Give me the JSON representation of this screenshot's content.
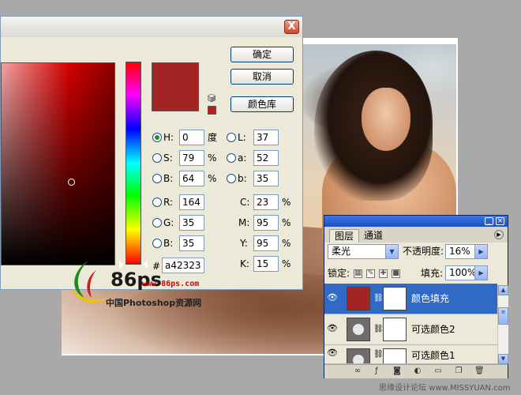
{
  "colors": {
    "selected_color": "#a42323",
    "web_swatch": "#b2221e",
    "layer_thumb": "#a42323"
  },
  "picker": {
    "close_label": "X",
    "buttons": {
      "ok": "确定",
      "cancel": "取消",
      "libraries": "颜色库"
    },
    "hsb": {
      "h": {
        "label": "H:",
        "value": "0",
        "unit": "度"
      },
      "s": {
        "label": "S:",
        "value": "79",
        "unit": "%"
      },
      "b": {
        "label": "B:",
        "value": "64",
        "unit": "%"
      }
    },
    "rgb": {
      "r": {
        "label": "R:",
        "value": "164"
      },
      "g": {
        "label": "G:",
        "value": "35"
      },
      "b": {
        "label": "B:",
        "value": "35"
      }
    },
    "lab": {
      "l": {
        "label": "L:",
        "value": "37"
      },
      "a": {
        "label": "a:",
        "value": "52"
      },
      "b": {
        "label": "b:",
        "value": "35"
      }
    },
    "cmyk": {
      "c": {
        "label": "C:",
        "value": "23",
        "unit": "%"
      },
      "m": {
        "label": "M:",
        "value": "95",
        "unit": "%"
      },
      "y": {
        "label": "Y:",
        "value": "95",
        "unit": "%"
      },
      "k": {
        "label": "K:",
        "value": "15",
        "unit": "%"
      }
    },
    "hex": {
      "label": "#",
      "value": "a42323"
    }
  },
  "layers": {
    "tabs": [
      "图层",
      "通道"
    ],
    "blend_mode": "柔光",
    "opacity_label": "不透明度:",
    "opacity_value": "16%",
    "lock_label": "锁定:",
    "fill_label": "填充:",
    "fill_value": "100%",
    "rows": [
      {
        "name": "颜色填充",
        "selected": true
      },
      {
        "name": "可选颜色2",
        "selected": false
      },
      {
        "name": "可选颜色1",
        "selected": false
      }
    ]
  },
  "watermark": {
    "brand": "86ps",
    "url": "www.86ps.com",
    "subtitle": "中国Photoshop资源网",
    "footer": "思缘设计论坛 www.MISSYUAN.com"
  }
}
